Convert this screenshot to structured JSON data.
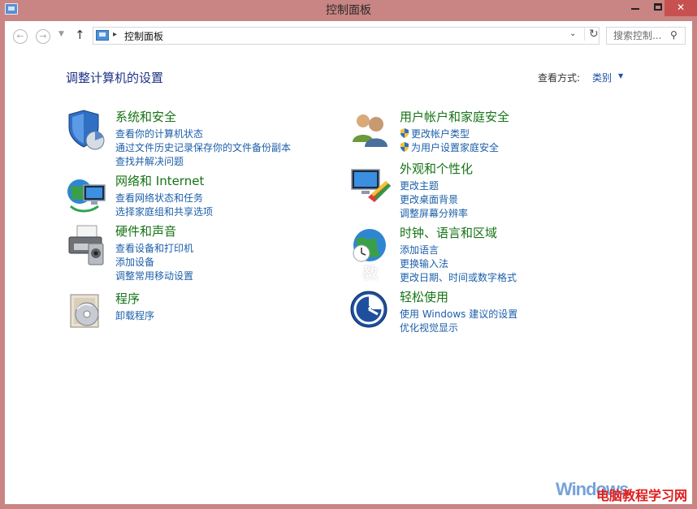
{
  "window": {
    "title": "控制面板",
    "minimize_label": "",
    "close_label": "✕"
  },
  "addressbar": {
    "path": "控制面板",
    "separator": "▸",
    "search_placeholder": "搜索控制..."
  },
  "header": {
    "title": "调整计算机的设置",
    "view_label": "查看方式:",
    "view_value": "类别"
  },
  "categories": [
    {
      "title": "系统和安全",
      "links": [
        "查看你的计算机状态",
        "通过文件历史记录保存你的文件备份副本",
        "查找并解决问题"
      ],
      "icon": "shield-icon"
    },
    {
      "title": "网络和 Internet",
      "links": [
        "查看网络状态和任务",
        "选择家庭组和共享选项"
      ],
      "icon": "network-globe-icon"
    },
    {
      "title": "硬件和声音",
      "links": [
        "查看设备和打印机",
        "添加设备",
        "调整常用移动设置"
      ],
      "icon": "printer-icon"
    },
    {
      "title": "程序",
      "links": [
        "卸载程序"
      ],
      "icon": "programs-icon"
    },
    {
      "title": "用户帐户和家庭安全",
      "links": [
        "更改帐户类型",
        "为用户设置家庭安全"
      ],
      "icon": "users-icon"
    },
    {
      "title": "外观和个性化",
      "links": [
        "更改主题",
        "更改桌面背景",
        "调整屏幕分辨率"
      ],
      "icon": "appearance-icon"
    },
    {
      "title": "时钟、语言和区域",
      "links": [
        "添加语言",
        "更换输入法",
        "更改日期、时间或数字格式"
      ],
      "icon": "clock-globe-icon"
    },
    {
      "title": "轻松使用",
      "links": [
        "使用 Windows 建议的设置",
        "优化视觉显示"
      ],
      "icon": "ease-of-access-icon"
    }
  ],
  "watermark": {
    "brand": "Windows",
    "site": "电脑教程学习网",
    "ghost": "教"
  },
  "colors": {
    "frame": "#c98583",
    "category_title": "#157315",
    "link": "#1c5fa9",
    "page_title": "#1e3287"
  }
}
